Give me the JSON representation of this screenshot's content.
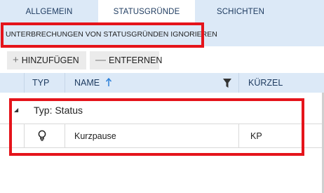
{
  "tabs": [
    {
      "label": "ALLGEMEIN"
    },
    {
      "label": "STATUSGRÜNDE",
      "active": true
    },
    {
      "label": "SCHICHTEN"
    }
  ],
  "banner": {
    "text": "UNTERBRECHUNGEN VON STATUSGRÜNDEN IGNORIEREN"
  },
  "toolbar": {
    "add_symbol": "+",
    "add_label": "HINZUFÜGEN",
    "remove_symbol": "—",
    "remove_label": "ENTFERNEN"
  },
  "grid": {
    "columns": {
      "typ": "TYP",
      "name": "NAME",
      "kuerzel": "KÜRZEL"
    },
    "sort_column": "NAME",
    "sort_direction": "ascending",
    "group": {
      "toggle": "◢",
      "label": "Typ: Status"
    },
    "rows": [
      {
        "icon": "lightbulb-icon",
        "name": "Kurzpause",
        "kuerzel": "KP"
      }
    ]
  },
  "colors": {
    "header_bg": "#dce9f7",
    "highlight": "#e5141b",
    "button_bg": "#ebebeb"
  }
}
